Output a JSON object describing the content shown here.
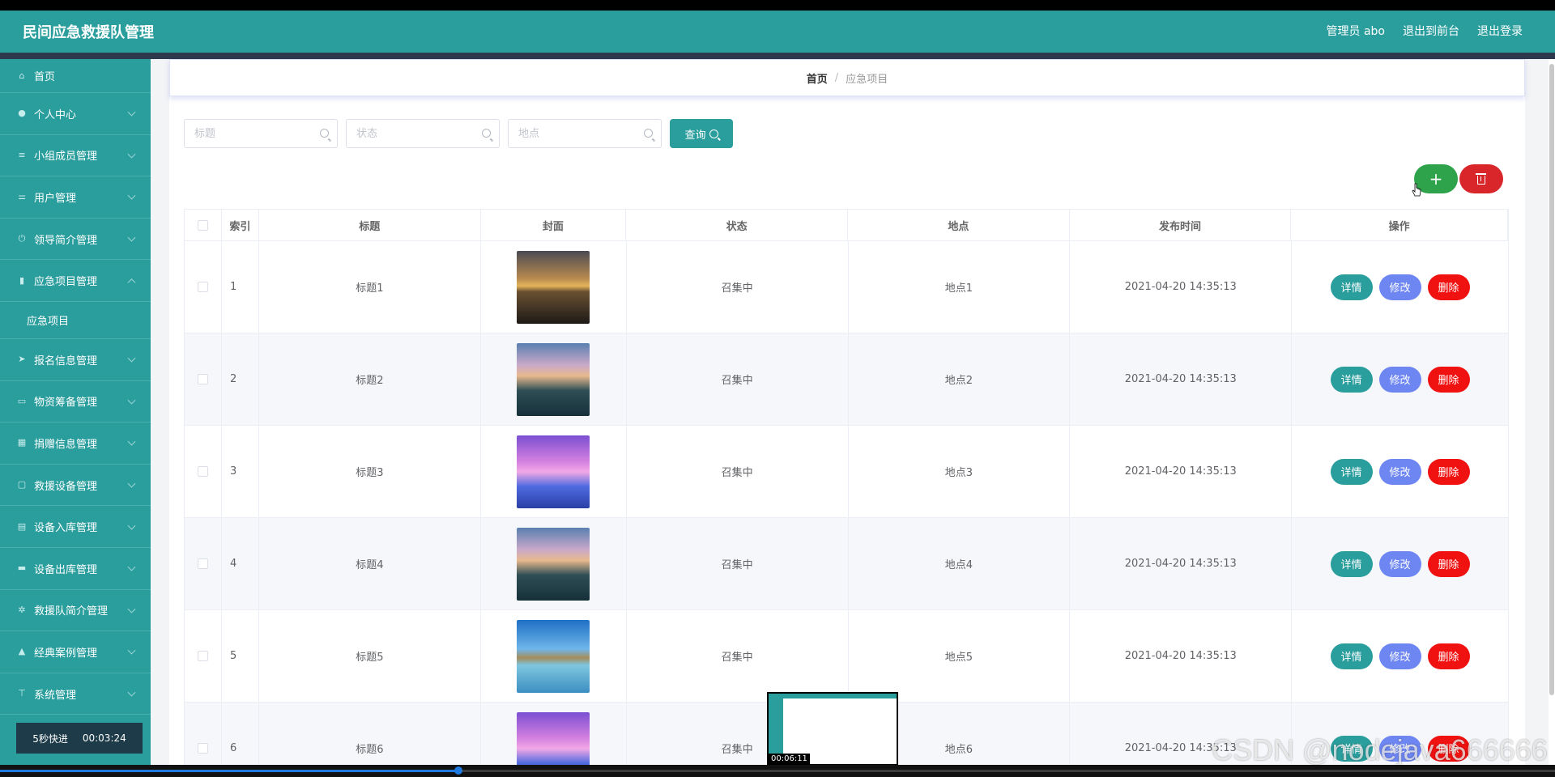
{
  "header": {
    "app_title": "民间应急救援队管理",
    "admin_label": "管理员 abo",
    "back_front": "退出到前台",
    "logout": "退出登录"
  },
  "sidebar": {
    "items": [
      {
        "label": "首页",
        "icon": "home-icon"
      },
      {
        "label": "个人中心",
        "icon": "user-icon"
      },
      {
        "label": "小组成员管理",
        "icon": "list-icon"
      },
      {
        "label": "用户管理",
        "icon": "sliders-icon"
      },
      {
        "label": "领导简介管理",
        "icon": "power-icon"
      },
      {
        "label": "应急项目管理",
        "icon": "clipboard-icon",
        "expanded": true,
        "sub": "应急项目"
      },
      {
        "label": "报名信息管理",
        "icon": "send-icon"
      },
      {
        "label": "物资筹备管理",
        "icon": "box-icon"
      },
      {
        "label": "捐赠信息管理",
        "icon": "grid-icon"
      },
      {
        "label": "救援设备管理",
        "icon": "chat-icon"
      },
      {
        "label": "设备入库管理",
        "icon": "briefcase-icon"
      },
      {
        "label": "设备出库管理",
        "icon": "monitor-icon"
      },
      {
        "label": "救援队简介管理",
        "icon": "settings-icon"
      },
      {
        "label": "经典案例管理",
        "icon": "thumb-icon"
      },
      {
        "label": "系统管理",
        "icon": "stamp-icon"
      }
    ],
    "fast_forward": "5秒快进",
    "fast_time": "00:03:24"
  },
  "breadcrumb": {
    "home": "首页",
    "sep": "/",
    "current": "应急项目"
  },
  "search": {
    "title_placeholder": "标题",
    "status_placeholder": "状态",
    "place_placeholder": "地点",
    "query_label": "查询"
  },
  "actions": {
    "add_label": "+"
  },
  "table": {
    "headers": {
      "index": "索引",
      "title": "标题",
      "cover": "封面",
      "status": "状态",
      "place": "地点",
      "time": "发布时间",
      "ops": "操作"
    },
    "ops": {
      "detail": "详情",
      "edit": "修改",
      "delete": "删除"
    },
    "rows": [
      {
        "index": "1",
        "title": "标题1",
        "status": "召集中",
        "place": "地点1",
        "time": "2021-04-20 14:35:13",
        "cover": "lake-tree"
      },
      {
        "index": "2",
        "title": "标题2",
        "status": "召集中",
        "place": "地点2",
        "time": "2021-04-20 14:35:13",
        "cover": "island-sunset"
      },
      {
        "index": "3",
        "title": "标题3",
        "status": "召集中",
        "place": "地点3",
        "time": "2021-04-20 14:35:13",
        "cover": "pink-palm"
      },
      {
        "index": "4",
        "title": "标题4",
        "status": "召集中",
        "place": "地点4",
        "time": "2021-04-20 14:35:13",
        "cover": "island-sunset"
      },
      {
        "index": "5",
        "title": "标题5",
        "status": "召集中",
        "place": "地点5",
        "time": "2021-04-20 14:35:13",
        "cover": "mountain-lake"
      },
      {
        "index": "6",
        "title": "标题6",
        "status": "召集中",
        "place": "地点6",
        "time": "2021-04-20 14:35:13",
        "cover": "pink-palm"
      }
    ]
  },
  "overlay": {
    "thumb_time": "00:06:11",
    "watermark": "CSDN @nodejava666666"
  },
  "video": {
    "progress": 0.295
  },
  "colors": {
    "primary": "#2a9d9d",
    "success": "#2fa24c",
    "danger": "#d8262a",
    "edit": "#6e86f2",
    "delete": "#f01111"
  }
}
